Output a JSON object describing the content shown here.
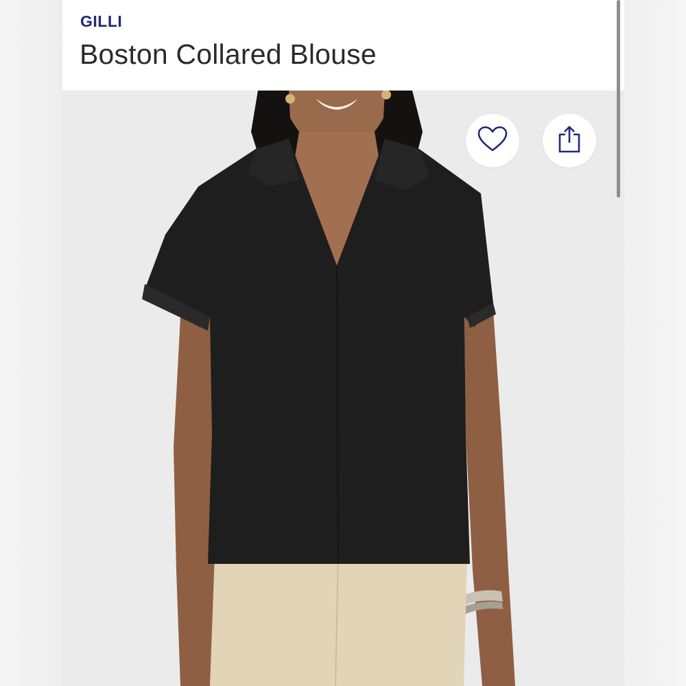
{
  "product": {
    "brand": "GILLI",
    "title": "Boston Collared Blouse"
  },
  "image": {
    "subject": "product-photo"
  },
  "actions": {
    "favorite_icon": "heart-icon",
    "share_icon": "share-icon"
  },
  "colors": {
    "brand_text": "#1f2a7a",
    "title_text": "#2a2a2a",
    "icon_stroke": "#1f2a7a",
    "header_bg": "#ffffff",
    "photo_bg": "#ebebec"
  }
}
